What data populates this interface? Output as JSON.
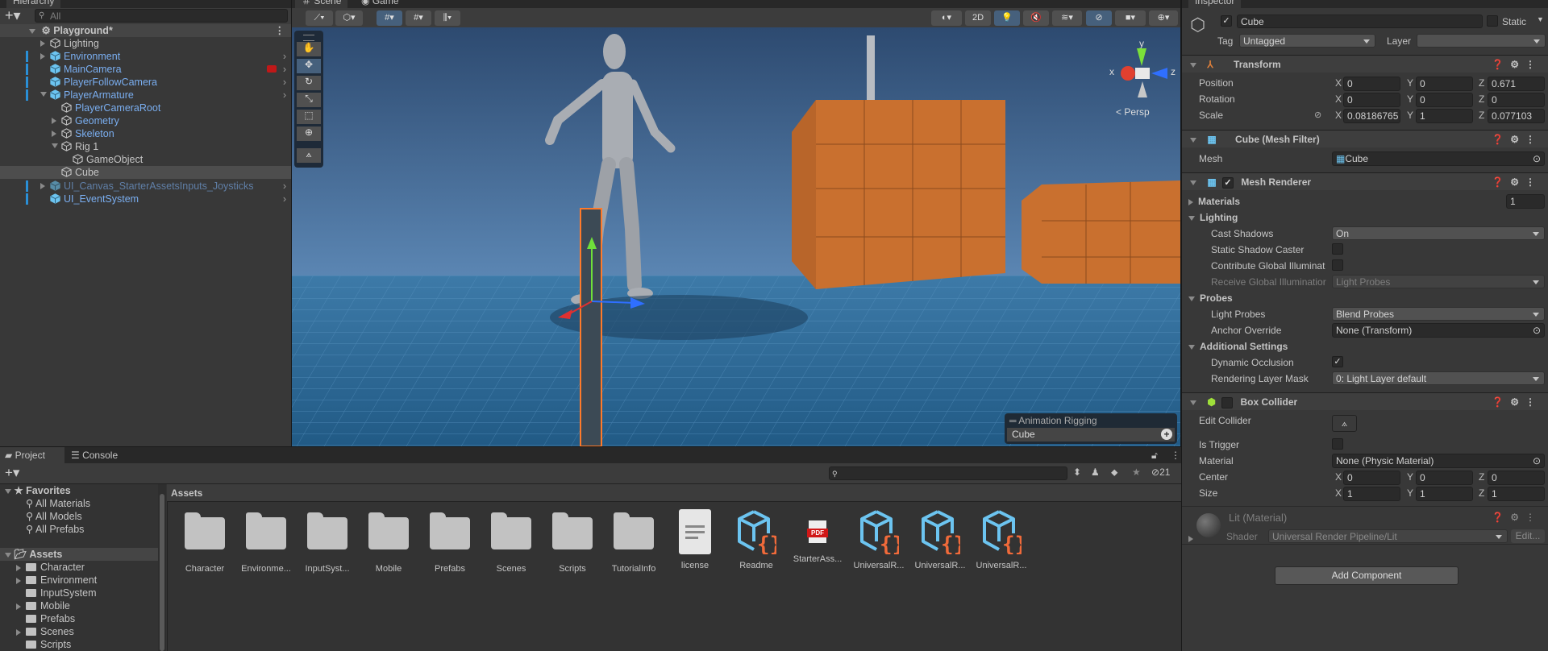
{
  "hierarchy": {
    "tab": "Hierarchy",
    "search_placeholder": "All",
    "scene": "Playground*",
    "items": [
      {
        "label": "Lighting",
        "depth": 1,
        "arrow": "right",
        "prefab": false
      },
      {
        "label": "Environment",
        "depth": 1,
        "arrow": "right",
        "prefab": true
      },
      {
        "label": "MainCamera",
        "depth": 1,
        "arrow": "",
        "prefab": true
      },
      {
        "label": "PlayerFollowCamera",
        "depth": 1,
        "arrow": "",
        "prefab": true
      },
      {
        "label": "PlayerArmature",
        "depth": 1,
        "arrow": "down",
        "prefab": true
      },
      {
        "label": "PlayerCameraRoot",
        "depth": 2,
        "arrow": "",
        "prefab": false,
        "blue": true
      },
      {
        "label": "Geometry",
        "depth": 2,
        "arrow": "right",
        "prefab": false,
        "blue": true
      },
      {
        "label": "Skeleton",
        "depth": 2,
        "arrow": "right",
        "prefab": false,
        "blue": true
      },
      {
        "label": "Rig 1",
        "depth": 2,
        "arrow": "down",
        "prefab": false
      },
      {
        "label": "GameObject",
        "depth": 3,
        "arrow": "",
        "prefab": false
      },
      {
        "label": "Cube",
        "depth": 2,
        "arrow": "",
        "prefab": false,
        "selected": true
      },
      {
        "label": "UI_Canvas_StarterAssetsInputs_Joysticks",
        "depth": 1,
        "arrow": "right",
        "prefab": true,
        "faded": true
      },
      {
        "label": "UI_EventSystem",
        "depth": 1,
        "arrow": "",
        "prefab": true
      }
    ]
  },
  "scene": {
    "tabs": [
      "Scene",
      "Game"
    ],
    "toolbar": {
      "mode_2d": "2D"
    },
    "persp": "Persp",
    "gizmo": {
      "x": "x",
      "y": "y",
      "z": "z"
    },
    "overlay": {
      "title": "Animation Rigging",
      "item": "Cube"
    }
  },
  "inspector": {
    "tab": "Inspector",
    "name": "Cube",
    "static": "Static",
    "tag_label": "Tag",
    "tag": "Untagged",
    "layer_label": "Layer",
    "layer": "",
    "transform": {
      "title": "Transform",
      "rows": [
        {
          "label": "Position",
          "x": "0",
          "y": "0",
          "z": "0.671"
        },
        {
          "label": "Rotation",
          "x": "0",
          "y": "0",
          "z": "0"
        },
        {
          "label": "Scale",
          "x": "0.08186765",
          "y": "1",
          "z": "0.077103"
        }
      ]
    },
    "mesh_filter": {
      "title": "Cube (Mesh Filter)",
      "mesh_label": "Mesh",
      "mesh": "Cube"
    },
    "mesh_renderer": {
      "title": "Mesh Renderer",
      "materials": "Materials",
      "materials_count": "1",
      "lighting": "Lighting",
      "cast_shadows": "Cast Shadows",
      "cast_shadows_value": "On",
      "static_shadow": "Static Shadow Caster",
      "contribute_gi": "Contribute Global Illuminat",
      "receive_gi": "Receive Global Illuminatior",
      "receive_gi_value": "Light Probes",
      "probes": "Probes",
      "light_probes": "Light Probes",
      "light_probes_value": "Blend Probes",
      "anchor": "Anchor Override",
      "anchor_value": "None (Transform)",
      "additional": "Additional Settings",
      "dynamic_occlusion": "Dynamic Occlusion",
      "rendering_layer": "Rendering Layer Mask",
      "rendering_layer_value": "0: Light Layer default"
    },
    "box_collider": {
      "title": "Box Collider",
      "edit": "Edit Collider",
      "is_trigger": "Is Trigger",
      "material": "Material",
      "material_value": "None (Physic Material)",
      "center": {
        "label": "Center",
        "x": "0",
        "y": "0",
        "z": "0"
      },
      "size": {
        "label": "Size",
        "x": "1",
        "y": "1",
        "z": "1"
      }
    },
    "material": {
      "title": "Lit (Material)",
      "shader_label": "Shader",
      "shader": "Universal Render Pipeline/Lit",
      "edit": "Edit..."
    },
    "add_component": "Add Component"
  },
  "project": {
    "tabs": [
      "Project",
      "Console"
    ],
    "hidden_count": "21",
    "favorites": "Favorites",
    "fav_items": [
      "All Materials",
      "All Models",
      "All Prefabs"
    ],
    "assets_root": "Assets",
    "tree": [
      {
        "label": "Character",
        "arrow": true
      },
      {
        "label": "Environment",
        "arrow": true
      },
      {
        "label": "InputSystem",
        "arrow": false
      },
      {
        "label": "Mobile",
        "arrow": true
      },
      {
        "label": "Prefabs",
        "arrow": false
      },
      {
        "label": "Scenes",
        "arrow": true
      },
      {
        "label": "Scripts",
        "arrow": false
      }
    ],
    "breadcrumb": "Assets",
    "assets": [
      {
        "label": "Character",
        "type": "folder"
      },
      {
        "label": "Environme...",
        "type": "folder"
      },
      {
        "label": "InputSyst...",
        "type": "folder"
      },
      {
        "label": "Mobile",
        "type": "folder"
      },
      {
        "label": "Prefabs",
        "type": "folder"
      },
      {
        "label": "Scenes",
        "type": "folder"
      },
      {
        "label": "Scripts",
        "type": "folder"
      },
      {
        "label": "TutorialInfo",
        "type": "folder"
      },
      {
        "label": "license",
        "type": "text"
      },
      {
        "label": "Readme",
        "type": "script"
      },
      {
        "label": "StarterAss...",
        "type": "pdf"
      },
      {
        "label": "UniversalR...",
        "type": "script"
      },
      {
        "label": "UniversalR...",
        "type": "script"
      },
      {
        "label": "UniversalR...",
        "type": "script"
      }
    ]
  },
  "colors": {
    "accent": "#46607c",
    "selection": "#4d4d4d",
    "prefab": "#7aaef0",
    "orange": "#e0803a"
  }
}
